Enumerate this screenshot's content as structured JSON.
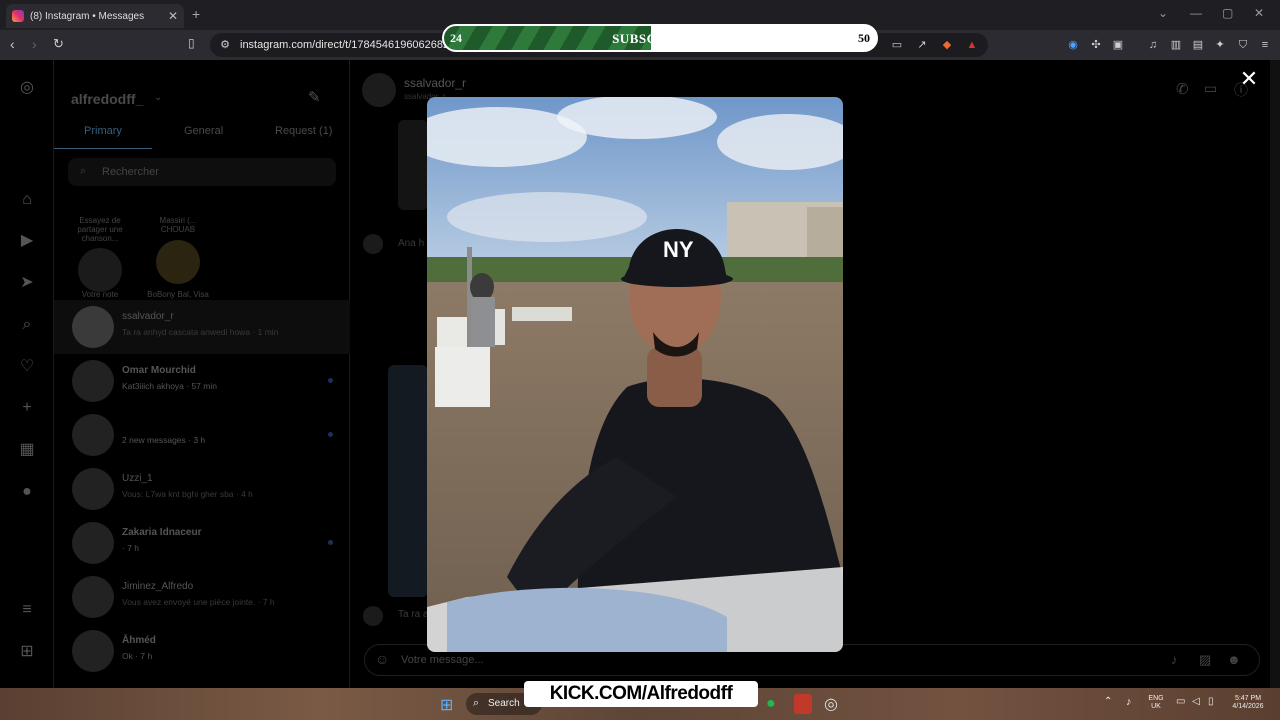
{
  "browser": {
    "tab_title": "(8) Instagram • Messages",
    "new_tab": "+",
    "url": "instagram.com/direct/t/17845461960626823"
  },
  "stream_overlay": {
    "subscribers_label": "SUBSCRIBERS",
    "current": "24",
    "goal": "50",
    "progress_fraction": 0.48,
    "kick_label": "KICK.COM/Alfredodff"
  },
  "instagram": {
    "username": "alfredodff_",
    "tabs": {
      "primary": "Primary",
      "general": "General",
      "request": "Request (1)"
    },
    "search_placeholder": "Rechercher",
    "notes": [
      {
        "bubble": "Essayez de partager une chanson...",
        "label": "Votre note"
      },
      {
        "bubble": "Massiri (... CHOUAB",
        "label": "BoBony Bal, Visa"
      }
    ],
    "conversations": [
      {
        "name": "ssalvador_r",
        "preview": "Ta ra anhyd cascata anwedi howa · 1 min"
      },
      {
        "name": "Omar Mourchid",
        "preview": "Kat3iiich akhoya · 57 min"
      },
      {
        "name": "",
        "preview": "2 new messages · 3 h"
      },
      {
        "name": "Uzzi_1",
        "preview": "Vous: L7wa knt bghi gher sba · 4 h"
      },
      {
        "name": "Zakaria Idnaceur",
        "preview": "· 7 h"
      },
      {
        "name": "Jiminez_Alfredo",
        "preview": "Vous avez envoyé une pièce jointe. · 7 h"
      },
      {
        "name": "Āhméd",
        "preview": "Ok · 7 h"
      }
    ],
    "chat": {
      "name": "ssalvador_r",
      "handle": "ssalvador_r",
      "message_placeholder": "Votre message...",
      "snippet_1": "Ana h",
      "snippet_2": "Ta ra a"
    }
  },
  "taskbar": {
    "search": "Search",
    "lang": "ENG",
    "region": "UK",
    "time": "5:47 PM",
    "date": "4/14/2026"
  }
}
